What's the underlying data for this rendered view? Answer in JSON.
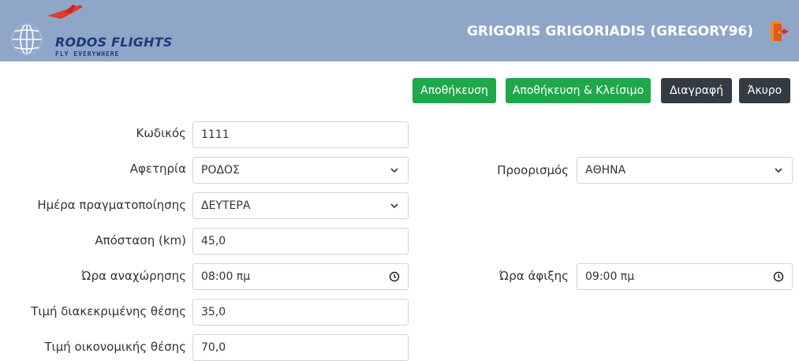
{
  "header": {
    "logo_title": "RODOS FLIGHTS",
    "logo_tagline": "FLY EVERYWHERE",
    "user": "GRIGORIS GRIGORIADIS (GREGORY96)",
    "logout_icon": "door-exit-icon",
    "background": "#8fa6c9"
  },
  "toolbar": {
    "save": "Αποθήκευση",
    "save_close": "Αποθήκευση & Κλείσιμο",
    "delete": "Διαγραφή",
    "cancel": "Άκυρο"
  },
  "form": {
    "code": {
      "label": "Κωδικός",
      "value": "1111"
    },
    "origin": {
      "label": "Αφετηρία",
      "value": "ΡΟΔΟΣ"
    },
    "destination": {
      "label": "Προορισμός",
      "value": "ΑΘΗΝΑ"
    },
    "day": {
      "label": "Ημέρα πραγματοποίησης",
      "value": "ΔΕΥΤΕΡΑ"
    },
    "distance": {
      "label": "Απόσταση (km)",
      "value": "45,0"
    },
    "departure": {
      "label": "Ώρα αναχώρησης",
      "value": "08:00 πμ"
    },
    "arrival": {
      "label": "Ώρα άφιξης",
      "value": "09:00 πμ"
    },
    "business_price": {
      "label": "Τιμή διακεκριμένης θέσης",
      "value": "35,0"
    },
    "economy_price": {
      "label": "Τιμή οικονομικής θέσης",
      "value": "70,0"
    }
  },
  "colors": {
    "green_button": "#1ea84a",
    "dark_button": "#333b43"
  }
}
